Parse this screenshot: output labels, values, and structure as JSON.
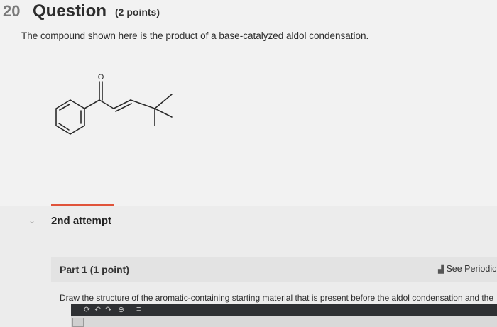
{
  "question": {
    "number": "20",
    "title": "Question",
    "points": "(2 points)",
    "text": "The compound shown here is the product of a base-catalyzed aldol condensation."
  },
  "molecule": {
    "atoms": [
      {
        "symbol": "O"
      }
    ]
  },
  "attempt": {
    "chevron": "⌄",
    "label": "2nd attempt"
  },
  "part": {
    "label": "Part 1   (1 point)",
    "periodic_icon": "bar-chart-icon",
    "periodic_label": "See Periodic"
  },
  "instruction": "Draw the structure of the aromatic-containing starting material that is present before the aldol condensation and the",
  "toolbar": {
    "buttons": [
      {
        "name": "clear-icon",
        "glyph": "⟳"
      },
      {
        "name": "undo-icon",
        "glyph": "↶"
      },
      {
        "name": "redo-icon",
        "glyph": "↷"
      },
      {
        "name": "zoom-icon",
        "glyph": "⊕"
      },
      {
        "name": "template-icon",
        "glyph": "≡"
      }
    ]
  }
}
